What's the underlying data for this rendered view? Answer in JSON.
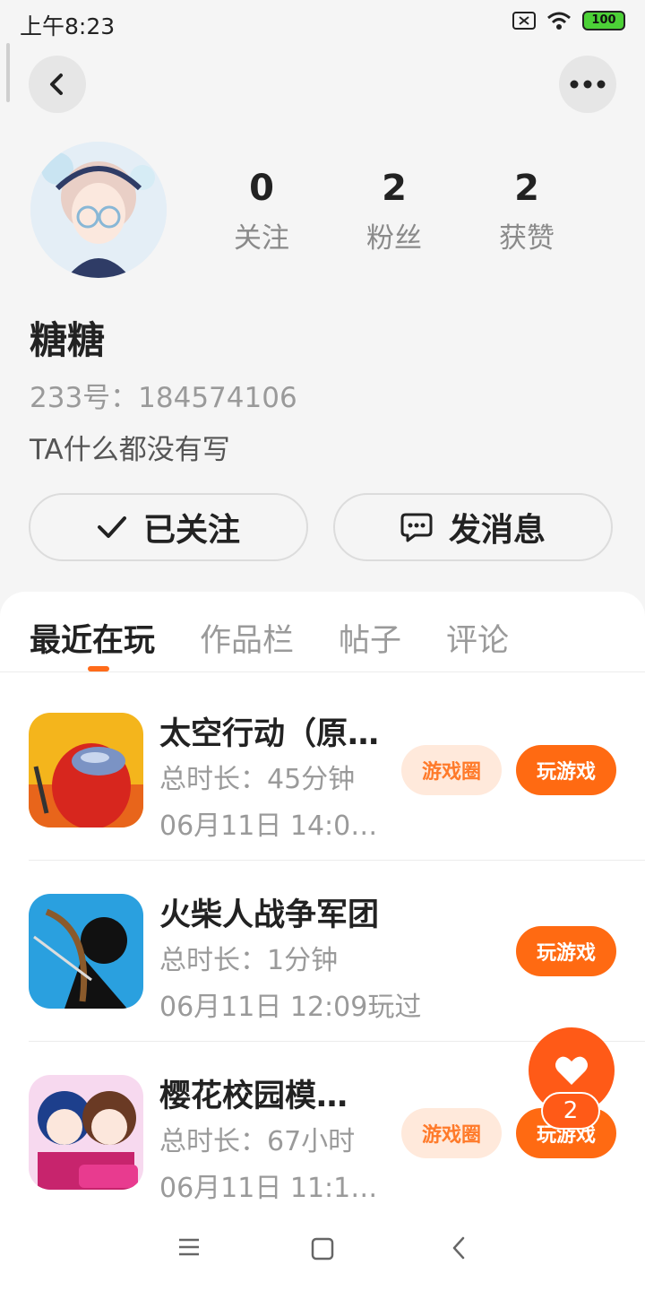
{
  "status_bar": {
    "time": "上午8:23",
    "battery": "100"
  },
  "profile": {
    "stats": [
      {
        "value": "0",
        "label": "关注"
      },
      {
        "value": "2",
        "label": "粉丝"
      },
      {
        "value": "2",
        "label": "获赞"
      }
    ],
    "name": "糖糖",
    "id_line": "233号：184574106",
    "bio": "TA什么都没有写"
  },
  "actions": {
    "follow_label": "已关注",
    "message_label": "发消息"
  },
  "tabs": [
    {
      "label": "最近在玩",
      "active": true
    },
    {
      "label": "作品栏",
      "active": false
    },
    {
      "label": "帖子",
      "active": false
    },
    {
      "label": "评论",
      "active": false
    }
  ],
  "games": [
    {
      "title": "太空行动（原…",
      "duration": "总时长：45分钟",
      "last_played": "06月11日 14:0…",
      "circle_label": "游戏圈",
      "play_label": "玩游戏"
    },
    {
      "title": "火柴人战争军团",
      "duration": "总时长：1分钟",
      "last_played": "06月11日 12:09玩过",
      "play_label": "玩游戏"
    },
    {
      "title": "樱花校园模…",
      "duration": "总时长：67小时",
      "last_played": "06月11日 11:1…",
      "circle_label": "游戏圈",
      "play_label": "玩游戏"
    }
  ],
  "like": {
    "count": "2"
  },
  "colors": {
    "accent": "#ff6a12",
    "accent_light": "#ffe9db"
  }
}
